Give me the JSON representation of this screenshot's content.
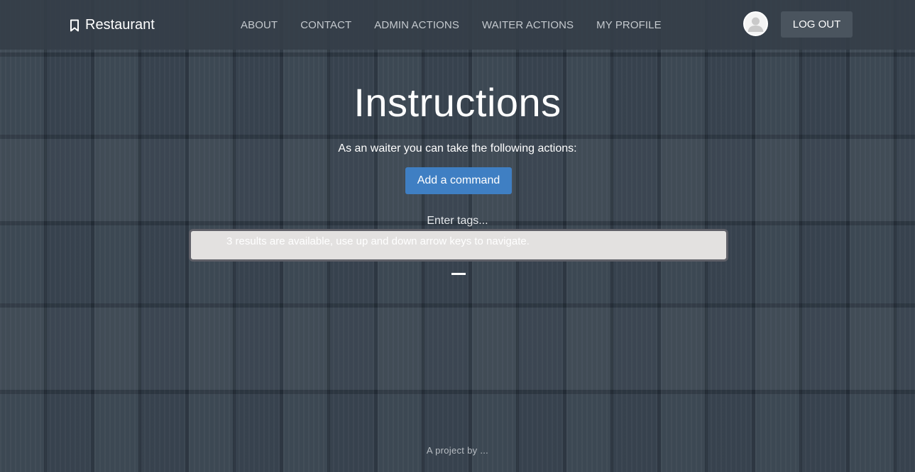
{
  "brand": {
    "name": "Restaurant",
    "icon": "bookmark-icon"
  },
  "nav": {
    "items": [
      {
        "label": "ABOUT"
      },
      {
        "label": "CONTACT"
      },
      {
        "label": "ADMIN ACTIONS"
      },
      {
        "label": "WAITER ACTIONS"
      },
      {
        "label": "MY PROFILE"
      }
    ],
    "avatar_icon": "user-avatar-icon",
    "logout_label": "LOG OUT"
  },
  "main": {
    "title": "Instructions",
    "subtitle": "As an waiter you can take the following actions:",
    "add_command_label": "Add a command",
    "tags_label": "Enter tags...",
    "tags_status": "3 results are available, use up and down arrow keys to navigate."
  },
  "footer": {
    "text": "A project by ..."
  },
  "colors": {
    "navbar": "#343e48",
    "primary_button": "#3f7fc3",
    "logout_button": "#4a545e",
    "tags_box": "#e3e1e0",
    "tags_border": "#5f6068"
  }
}
